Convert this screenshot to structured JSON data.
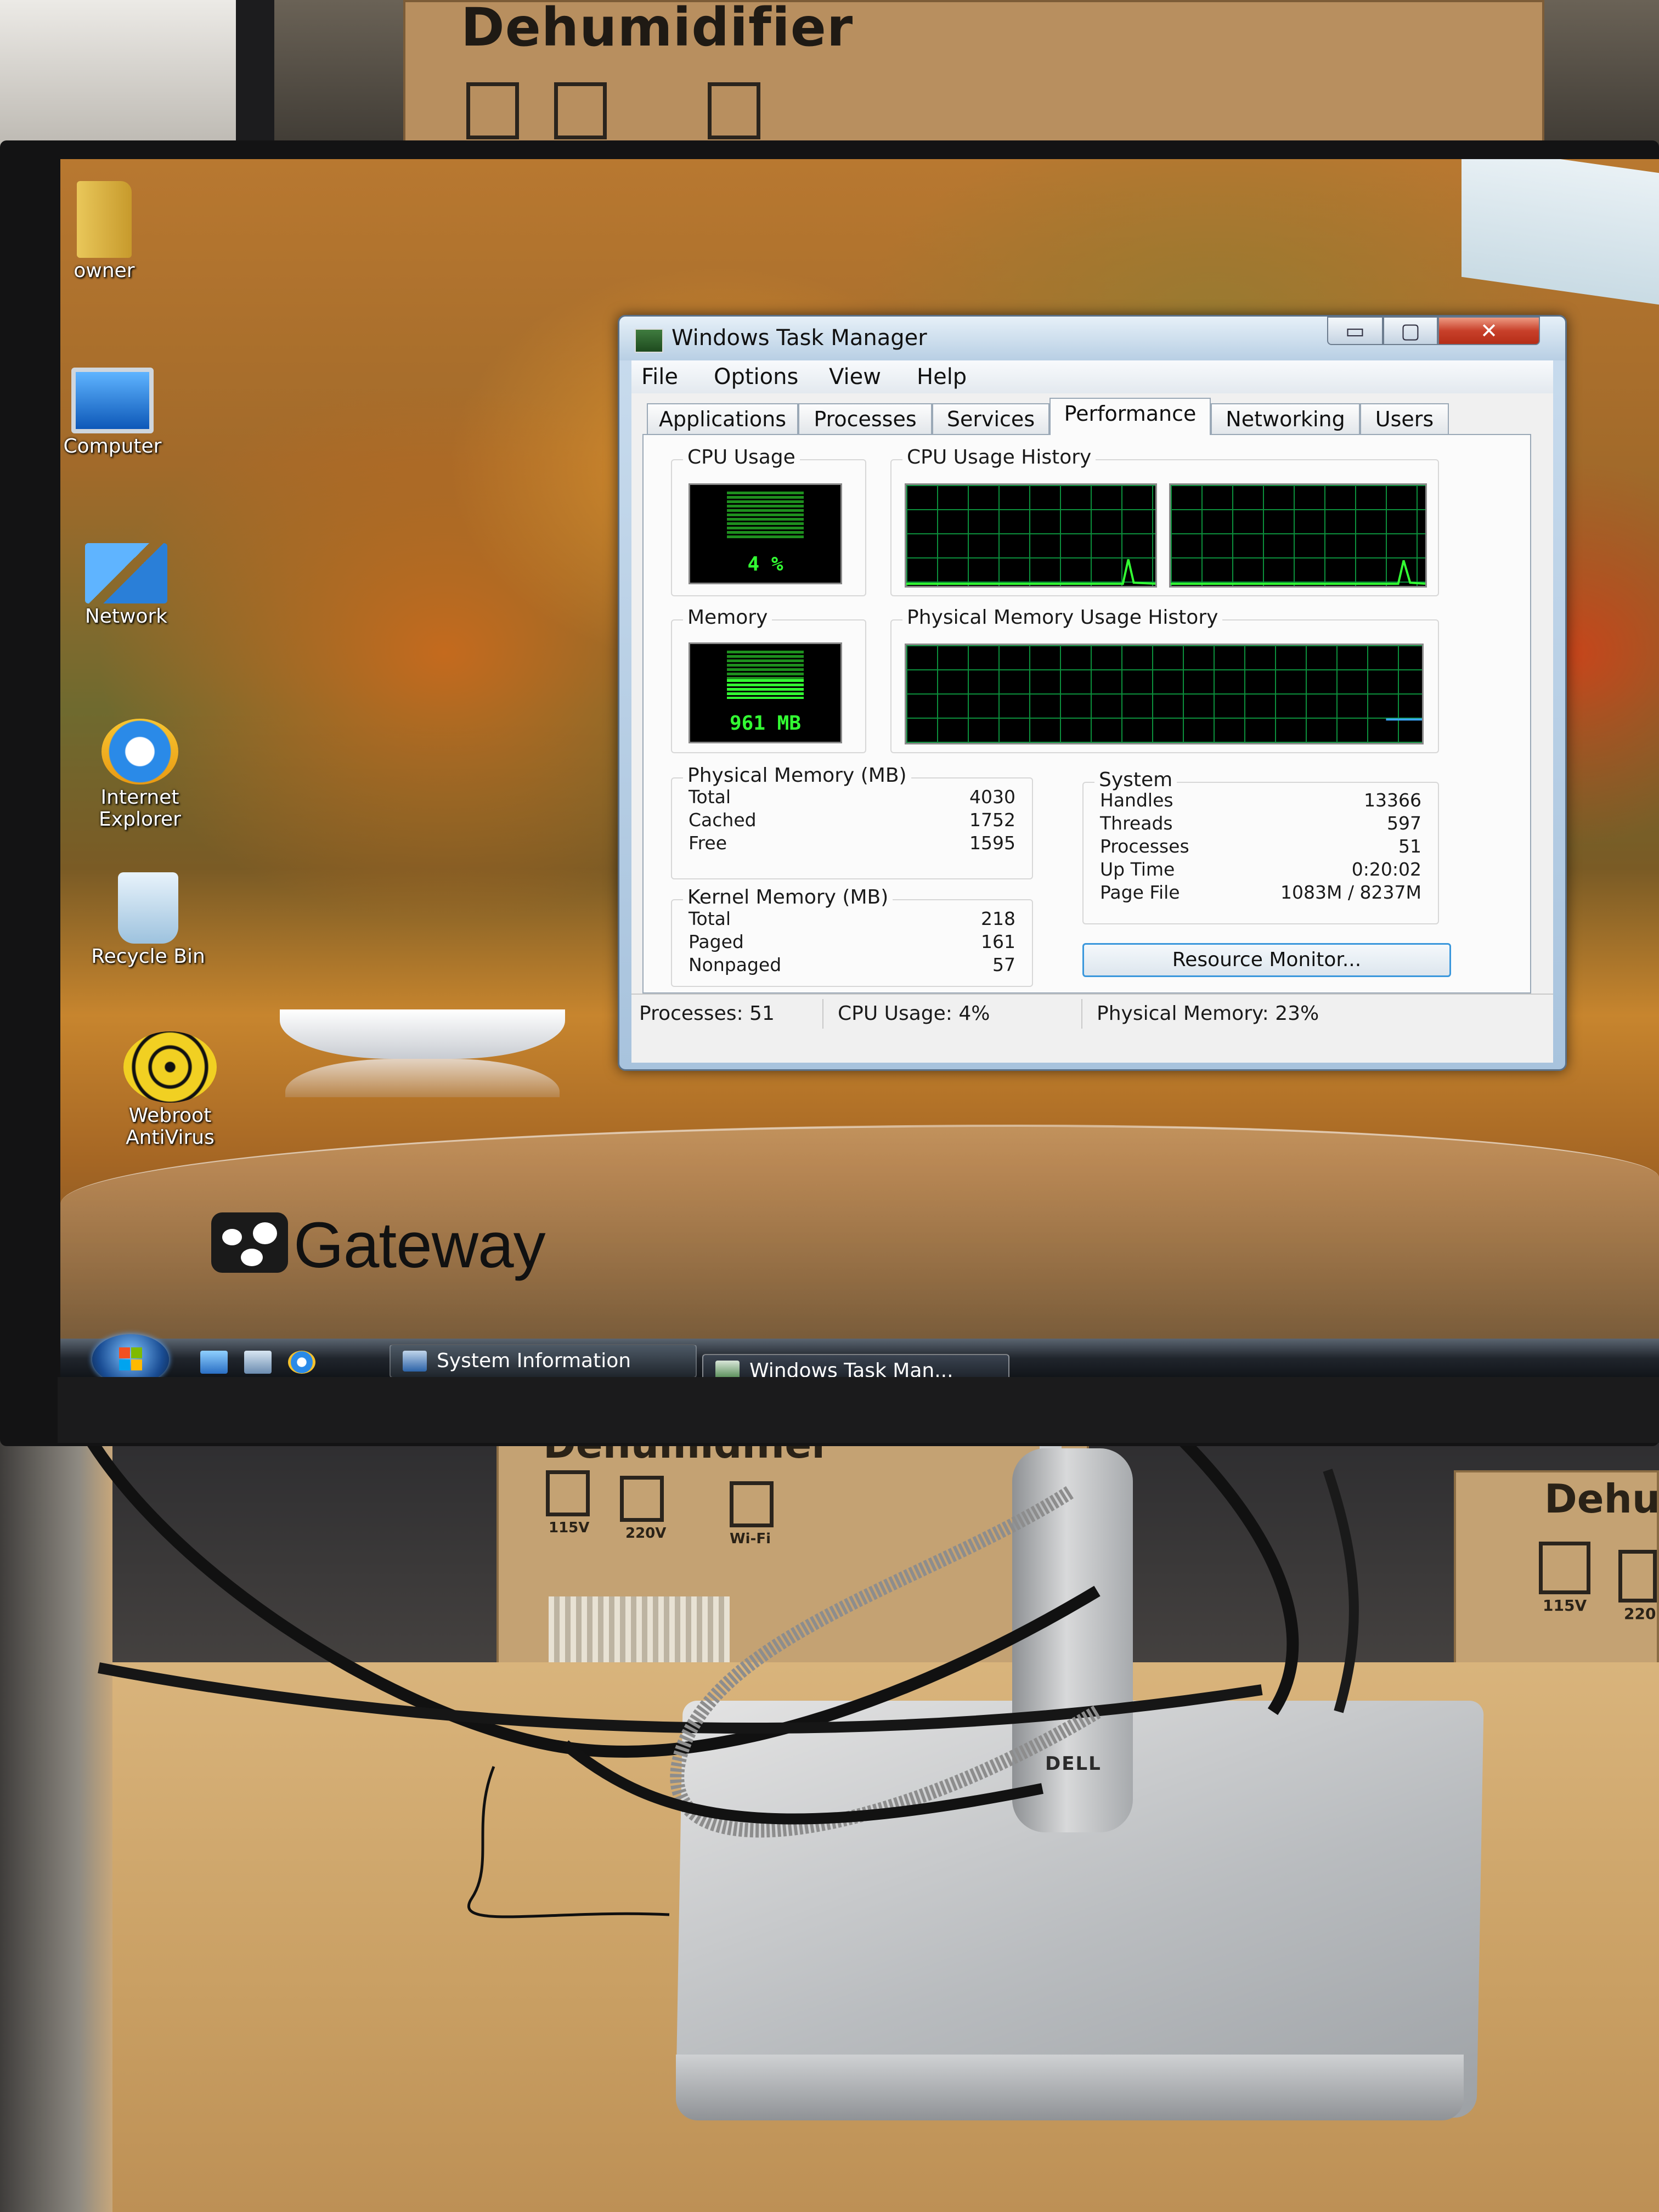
{
  "scene": {
    "box_label_top": "Dehumidifier",
    "box_label_back": "Dehumidifier",
    "box_label_right": "Dehu",
    "box_checkbox_labels": [
      "115V",
      "220V",
      "Wi-Fi"
    ],
    "box_checkbox_labels_right": [
      "115V",
      "220"
    ],
    "monitor_brand": "DELL"
  },
  "desktop": {
    "icons": [
      {
        "label": "owner",
        "icon": "user-folder-icon"
      },
      {
        "label": "Computer",
        "icon": "computer-icon"
      },
      {
        "label": "Network",
        "icon": "network-icon"
      },
      {
        "label": "Internet Explorer",
        "icon": "internet-explorer-icon"
      },
      {
        "label": "Recycle Bin",
        "icon": "recycle-bin-icon"
      },
      {
        "label": "Webroot AntiVirus",
        "icon": "webroot-antivirus-icon"
      }
    ],
    "brand_logo_text": "Gateway"
  },
  "taskbar": {
    "buttons": [
      {
        "label": "System Information",
        "icon": "system-information-icon"
      },
      {
        "label": "Windows Task Man...",
        "icon": "task-manager-icon"
      }
    ],
    "quick_launch": [
      "show-desktop-icon",
      "switch-windows-icon",
      "internet-explorer-icon"
    ]
  },
  "task_manager": {
    "title": "Windows Task Manager",
    "caption_buttons": {
      "minimize": "▭",
      "maximize": "▢",
      "close": "✕"
    },
    "menu": [
      "File",
      "Options",
      "View",
      "Help"
    ],
    "tabs": [
      "Applications",
      "Processes",
      "Services",
      "Performance",
      "Networking",
      "Users"
    ],
    "active_tab": "Performance",
    "cpu_usage": {
      "title": "CPU Usage",
      "value_text": "4 %",
      "percent": 4
    },
    "cpu_history": {
      "title": "CPU Usage History"
    },
    "memory": {
      "title": "Memory",
      "value_text": "961 MB"
    },
    "memory_history": {
      "title": "Physical Memory Usage History"
    },
    "physical_memory": {
      "title": "Physical Memory (MB)",
      "rows": [
        {
          "label": "Total",
          "value": "4030"
        },
        {
          "label": "Cached",
          "value": "1752"
        },
        {
          "label": "Free",
          "value": "1595"
        }
      ]
    },
    "kernel_memory": {
      "title": "Kernel Memory (MB)",
      "rows": [
        {
          "label": "Total",
          "value": "218"
        },
        {
          "label": "Paged",
          "value": "161"
        },
        {
          "label": "Nonpaged",
          "value": "57"
        }
      ]
    },
    "system": {
      "title": "System",
      "rows": [
        {
          "label": "Handles",
          "value": "13366"
        },
        {
          "label": "Threads",
          "value": "597"
        },
        {
          "label": "Processes",
          "value": "51"
        },
        {
          "label": "Up Time",
          "value": "0:20:02"
        },
        {
          "label": "Page File",
          "value": "1083M / 8237M"
        }
      ]
    },
    "resource_monitor_button": "Resource Monitor...",
    "status": {
      "processes": "Processes: 51",
      "cpu": "CPU Usage: 4%",
      "memory": "Physical Memory: 23%"
    }
  }
}
